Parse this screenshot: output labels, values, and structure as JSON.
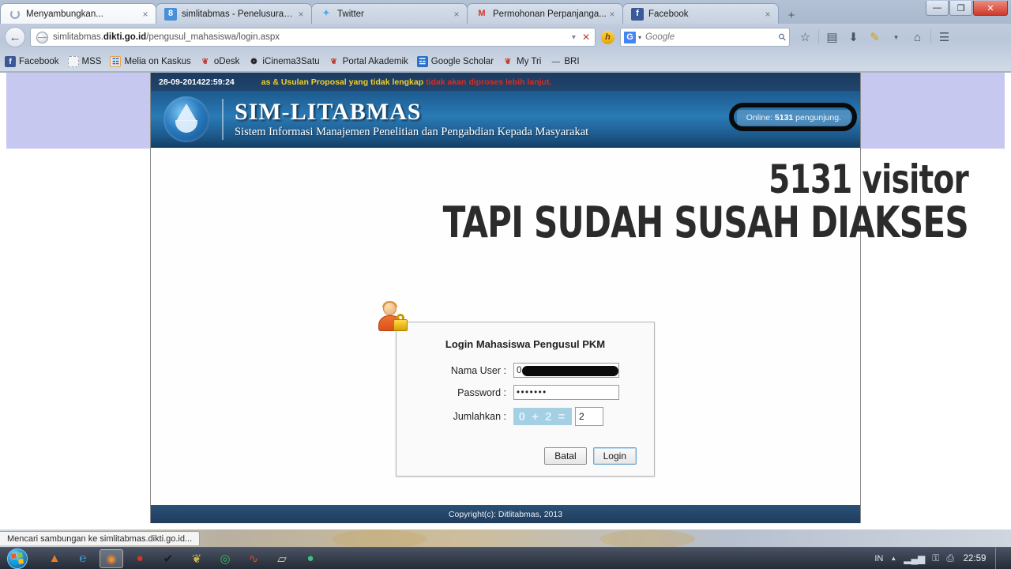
{
  "browser": {
    "tabs": [
      {
        "title": "Menyambungkan...",
        "favicon": "loading-spinner-icon",
        "active": true,
        "close": "×"
      },
      {
        "title": "simlitabmas - Penelusuran ...",
        "favicon": "google-blue-icon",
        "favicon_glyph": "8",
        "active": false,
        "close": "×"
      },
      {
        "title": "Twitter",
        "favicon": "twitter-bird-icon",
        "favicon_glyph": "✦",
        "active": false,
        "close": "×"
      },
      {
        "title": "Permohonan Perpanjanga...",
        "favicon": "gmail-icon",
        "favicon_glyph": "M",
        "active": false,
        "close": "×"
      },
      {
        "title": "Facebook",
        "favicon": "facebook-icon",
        "favicon_glyph": "f",
        "active": false,
        "close": "×"
      }
    ],
    "new_tab_label": "+",
    "window_controls": {
      "minimize": "—",
      "maximize": "❐",
      "close": "✕"
    },
    "back_label": "←",
    "url": {
      "prefix": "simlitabmas.",
      "domain": "dikti.go.id",
      "path": "/pengusul_mahasiswa/login.aspx"
    },
    "url_dropdown": "▾",
    "url_stop": "✕",
    "search": {
      "engine_glyph": "G",
      "caret": "▾",
      "placeholder": "Google",
      "magnifier": "⚲"
    },
    "toolbar_icons": [
      {
        "name": "bookmark-star-icon",
        "glyph": "☆"
      },
      {
        "name": "reading-list-icon",
        "glyph": "▤"
      },
      {
        "name": "downloads-icon",
        "glyph": "⬇"
      },
      {
        "name": "highlighter-icon",
        "glyph": "✎"
      },
      {
        "name": "overflow-caret-icon",
        "glyph": "▾"
      },
      {
        "name": "home-icon",
        "glyph": "⌂"
      },
      {
        "name": "menu-hamburger-icon",
        "glyph": "☰"
      }
    ],
    "bookmarks": [
      {
        "label": "Facebook",
        "icon": "facebook-icon",
        "glyph": "f",
        "cls": "bi-fb"
      },
      {
        "label": "MSS",
        "icon": "blank-page-icon",
        "glyph": "",
        "cls": "bi-mss"
      },
      {
        "label": "Melia on Kaskus",
        "icon": "kaskus-icon",
        "glyph": "☷",
        "cls": "bi-melia"
      },
      {
        "label": "oDesk",
        "icon": "odesk-icon",
        "glyph": "❦",
        "cls": "bi-odesk"
      },
      {
        "label": "iCinema3Satu",
        "icon": "cinema-icon",
        "glyph": "❁",
        "cls": "bi-cinema"
      },
      {
        "label": "Portal Akademik",
        "icon": "portal-icon",
        "glyph": "❦",
        "cls": "bi-portal"
      },
      {
        "label": "Google Scholar",
        "icon": "scholar-icon",
        "glyph": "☲",
        "cls": "bi-scholar"
      },
      {
        "label": "My Tri",
        "icon": "tri-icon",
        "glyph": "❦",
        "cls": "bi-mytri"
      },
      {
        "label": "BRI",
        "icon": "bri-icon",
        "glyph": "‒‒",
        "cls": "bi-bri"
      }
    ],
    "status_text": "Mencari sambungan ke simlitabmas.dikti.go.id..."
  },
  "site": {
    "date": "28-09-2014",
    "time": "22:59:24",
    "marquee_yellow": "as & Usulan Proposal yang tidak lengkap ",
    "marquee_red": "tidak akan diproses lebih lanjut.",
    "brand": "SIM-LITABMAS",
    "brand_subtitle": "Sistem Informasi Manajemen Penelitian dan Pengabdian Kepada Masyarakat",
    "online_prefix": "Online: ",
    "online_count": "5131",
    "online_suffix": " pengunjung.",
    "footer": "Copyright(c): Ditlitabmas, 2013"
  },
  "login": {
    "title": "Login Mahasiswa Pengusul PKM",
    "username_label": "Nama User :",
    "username_value": "0",
    "password_label": "Password :",
    "password_value": "•••••••",
    "captcha_label": "Jumlahkan :",
    "captcha_question": "0 + 2 =",
    "captcha_answer": "2",
    "cancel_label": "Batal",
    "submit_label": "Login"
  },
  "annotation": {
    "line1": "5131 visitor",
    "line2": "TAPI SUDAH SUSAH DIAKSES"
  },
  "taskbar": {
    "start_name": "windows-start-orb",
    "items": [
      {
        "name": "vlc-icon",
        "glyph": "▲"
      },
      {
        "name": "internet-explorer-icon",
        "glyph": "℮"
      },
      {
        "name": "firefox-icon",
        "glyph": "◉",
        "active": true
      },
      {
        "name": "opera-icon",
        "glyph": "●"
      },
      {
        "name": "checkmark-app-icon",
        "glyph": "✔"
      },
      {
        "name": "bug-app-icon",
        "glyph": "❦"
      },
      {
        "name": "chrome-icon",
        "glyph": "◎"
      },
      {
        "name": "red-curve-app-icon",
        "glyph": "∿"
      },
      {
        "name": "folder-explorer-icon",
        "glyph": "▱"
      },
      {
        "name": "green-app-icon",
        "glyph": "●"
      }
    ],
    "language": "IN",
    "tray": [
      {
        "name": "show-hidden-icons-arrow",
        "glyph": "▲"
      },
      {
        "name": "network-signal-icon",
        "glyph": "▂▄▆"
      },
      {
        "name": "security-lock-icon",
        "glyph": "⚿"
      },
      {
        "name": "removable-device-icon",
        "glyph": "⎙"
      }
    ],
    "clock": "22:59"
  },
  "colors": {
    "site_header_blue": "#1c5a8e",
    "site_topbar": "#1c3a5e",
    "marquee_yellow": "#f5d020",
    "marquee_red": "#e02b1d",
    "lavender_band": "#c6c8f0",
    "annotation_black": "#2b2b2b",
    "captcha_bg": "#a5cfe3"
  }
}
